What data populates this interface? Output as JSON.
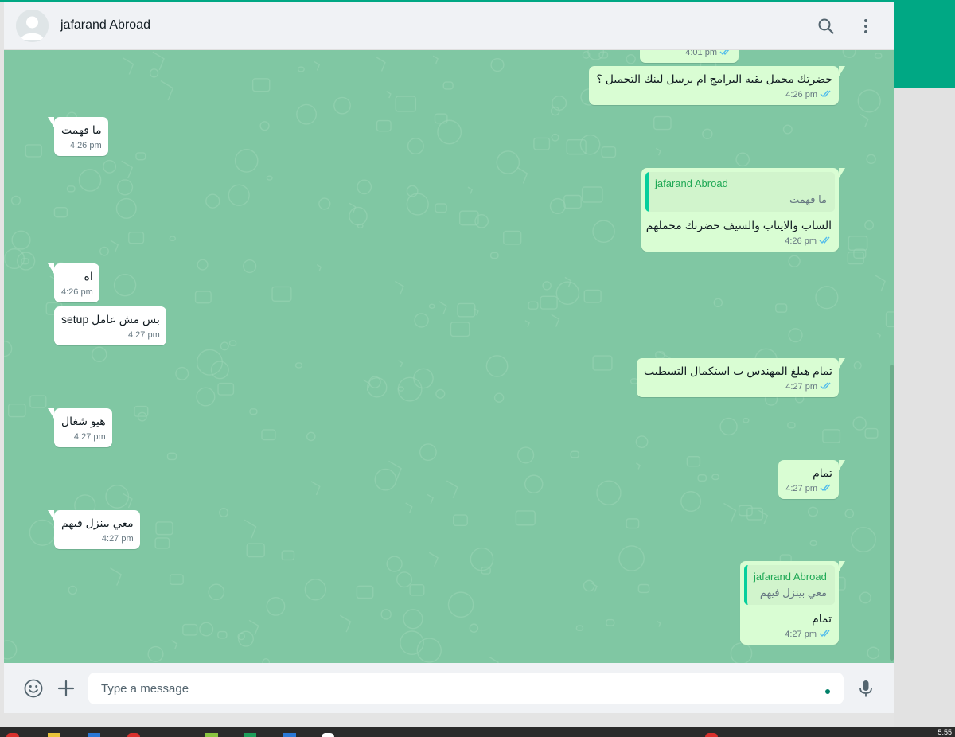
{
  "colors": {
    "accent": "#00a884",
    "chat_background": "#80c7a3",
    "outgoing_bubble": "#d9fdd3",
    "incoming_bubble": "#ffffff",
    "read_ticks": "#53bdeb",
    "quote_bar": "#06cf9c"
  },
  "header": {
    "contact_name": "jafarand Abroad",
    "avatar_icon": "default-avatar-icon",
    "search_icon": "search-icon",
    "menu_icon": "vertical-dots-menu-icon"
  },
  "messages": [
    {
      "dir": "out",
      "text": "",
      "time": "4:01 pm",
      "ticks": "double-check-icon"
    },
    {
      "dir": "out",
      "text": "حضرتك محمل بقيه البرامج ام برسل لينك التحميل ؟",
      "time": "4:26 pm",
      "ticks": "double-check-icon"
    },
    {
      "dir": "in",
      "text": "ما فهمت",
      "time": "4:26 pm"
    },
    {
      "dir": "out",
      "quote": {
        "name": "jafarand Abroad",
        "text": "ما فهمت"
      },
      "text": "الساب والايتاب والسيف حضرتك محملهم",
      "time": "4:26 pm",
      "ticks": "double-check-icon"
    },
    {
      "dir": "in",
      "text": "اه",
      "time": "4:26 pm"
    },
    {
      "dir": "in",
      "text": "بس مش عامل  setup",
      "time": "4:27 pm"
    },
    {
      "dir": "out",
      "text": "تمام هبلغ المهندس ب استكمال التسطيب",
      "time": "4:27 pm",
      "ticks": "double-check-icon"
    },
    {
      "dir": "in",
      "text": "هيو شغال",
      "time": "4:27 pm"
    },
    {
      "dir": "out",
      "text": "تمام",
      "time": "4:27 pm",
      "ticks": "double-check-icon"
    },
    {
      "dir": "in",
      "text": "معي بينزل فيهم",
      "time": "4:27 pm"
    },
    {
      "dir": "out",
      "quote": {
        "name": "jafarand Abroad",
        "text": "معي بينزل فيهم"
      },
      "text": "تمام",
      "time": "4:27 pm",
      "ticks": "double-check-icon"
    }
  ],
  "footer": {
    "emoji_icon": "emoji-icon",
    "attach_icon": "plus-icon",
    "mic_icon": "microphone-icon",
    "input_placeholder": "Type a message",
    "input_value": ""
  },
  "taskbar": {
    "clock": "5:55"
  }
}
